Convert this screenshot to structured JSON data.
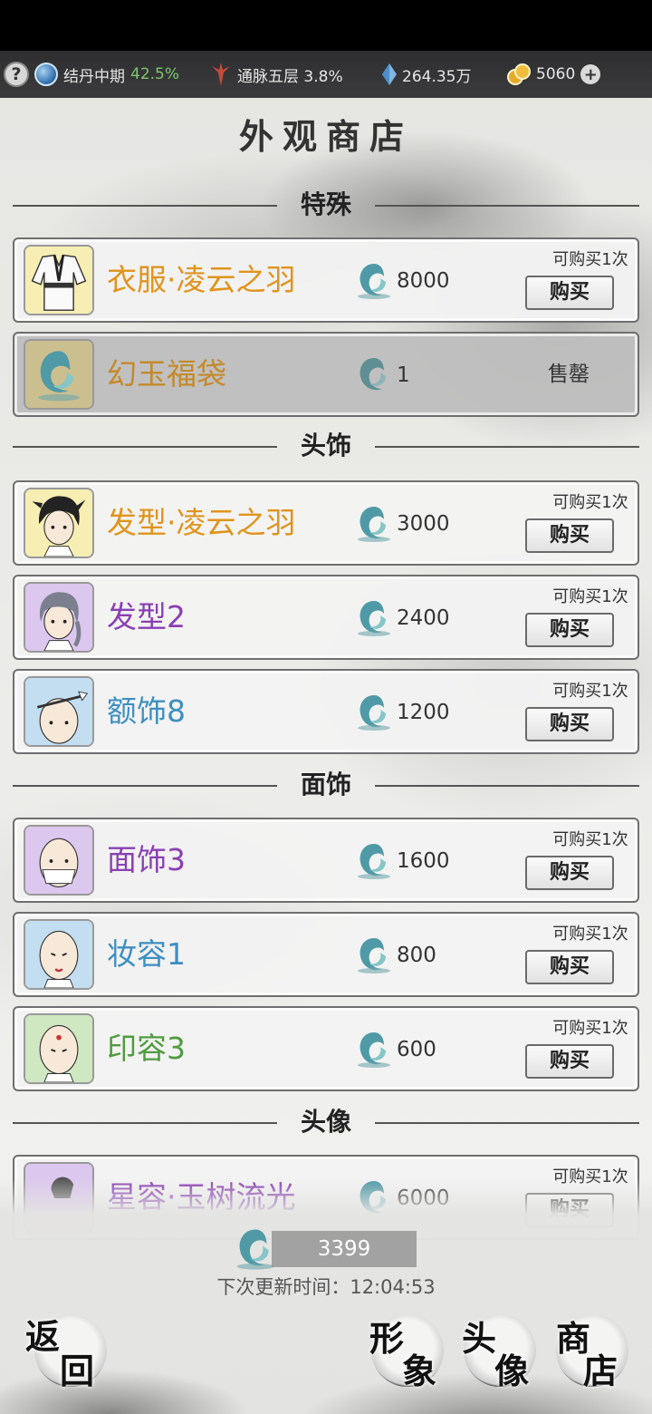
{
  "resources": {
    "realm": "结丹中期",
    "realm_progress": "42.5%",
    "meridian": "通脉五层 3.8%",
    "spirit_stones": "264.35万",
    "gold": "5060"
  },
  "page_title": "外观商店",
  "sections": [
    {
      "label": "特殊"
    },
    {
      "label": "头饰"
    },
    {
      "label": "面饰"
    },
    {
      "label": "头像"
    }
  ],
  "items": [
    {
      "name": "衣服·凌云之羽",
      "price": "8000",
      "limit": "可购买1次",
      "button": "购买",
      "name_color": "#e0941c",
      "bg": "#f6eeb3"
    },
    {
      "name": "幻玉福袋",
      "price": "1",
      "status": "售罄",
      "name_color": "#c48a2a",
      "bg": "#cbbf8f"
    },
    {
      "name": "发型·凌云之羽",
      "price": "3000",
      "limit": "可购买1次",
      "button": "购买",
      "name_color": "#e0941c",
      "bg": "#f6eeb3"
    },
    {
      "name": "发型2",
      "price": "2400",
      "limit": "可购买1次",
      "button": "购买",
      "name_color": "#8a3fb3",
      "bg": "#dcc7ee"
    },
    {
      "name": "额饰8",
      "price": "1200",
      "limit": "可购买1次",
      "button": "购买",
      "name_color": "#3d8fc1",
      "bg": "#c3def0"
    },
    {
      "name": "面饰3",
      "price": "1600",
      "limit": "可购买1次",
      "button": "购买",
      "name_color": "#8a3fb3",
      "bg": "#dcc7ee"
    },
    {
      "name": "妆容1",
      "price": "800",
      "limit": "可购买1次",
      "button": "购买",
      "name_color": "#3d8fc1",
      "bg": "#c3def0"
    },
    {
      "name": "印容3",
      "price": "600",
      "limit": "可购买1次",
      "button": "购买",
      "name_color": "#4f9b3f",
      "bg": "#cfe8c1"
    },
    {
      "name": "星容·玉树流光",
      "price": "6000",
      "limit": "可购买1次",
      "button": "购买",
      "name_color": "#8a3fb3",
      "bg": "#dcc7ee"
    }
  ],
  "footer": {
    "jade_balance": "3399",
    "refresh_text": "下次更新时间：12:04:53",
    "back_label": [
      "返",
      "回"
    ],
    "nav": [
      {
        "top": "形",
        "bottom": "象"
      },
      {
        "top": "头",
        "bottom": "像"
      },
      {
        "top": "商",
        "bottom": "店"
      }
    ]
  }
}
